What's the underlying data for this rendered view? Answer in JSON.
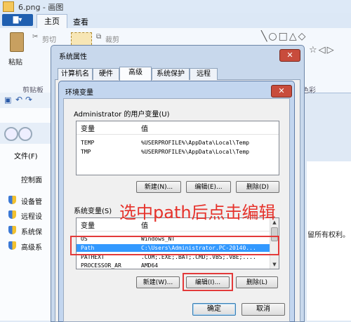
{
  "paint": {
    "title": "6.png - 画图",
    "file_menu": "▇▾",
    "tabs": [
      "主页",
      "查看"
    ],
    "ribbon": {
      "paste": "粘贴",
      "cut": "剪切",
      "crop": "裁剪",
      "clipboard_group": "剪贴板",
      "color_group": "色彩"
    }
  },
  "explorer": {
    "file_menu": "文件(F)",
    "items": [
      "控制面",
      "设备管",
      "远程设",
      "系统保",
      "高级系"
    ],
    "copyright_tail": "留所有权利。"
  },
  "sysprop": {
    "title": "系统属性",
    "close": "✕",
    "tabs": [
      "计算机名",
      "硬件",
      "高级",
      "系统保护",
      "远程"
    ]
  },
  "envvar": {
    "title": "环境变量",
    "close": "✕",
    "user_section": {
      "label": "Administrator 的用户变量(U)",
      "columns": [
        "变量",
        "值"
      ],
      "rows": [
        {
          "name": "TEMP",
          "value": "%USERPROFILE%\\AppData\\Local\\Temp"
        },
        {
          "name": "TMP",
          "value": "%USERPROFILE%\\AppData\\Local\\Temp"
        }
      ],
      "buttons": {
        "new": "新建(N)...",
        "edit": "编辑(E)...",
        "delete": "删除(D)"
      }
    },
    "system_section": {
      "label": "系统变量(S)",
      "columns": [
        "变量",
        "值"
      ],
      "rows": [
        {
          "name": "OS",
          "value": "Windows_NT",
          "selected": false
        },
        {
          "name": "Path",
          "value": "C:\\Users\\Administrator.PC-20140...",
          "selected": true
        },
        {
          "name": "PATHEXT",
          "value": ".COM;.EXE;.BAT;.CMD;.VBS;.VBE;....",
          "selected": false
        },
        {
          "name": "PROCESSOR_AR",
          "value": "AMD64",
          "selected": false
        }
      ],
      "buttons": {
        "new": "新建(W)...",
        "edit": "编辑(I)...",
        "delete": "删除(L)"
      }
    },
    "ok": "确定",
    "cancel": "取消"
  },
  "annotation": {
    "text": "选中path后点击编辑",
    "color": "#e6322b"
  }
}
